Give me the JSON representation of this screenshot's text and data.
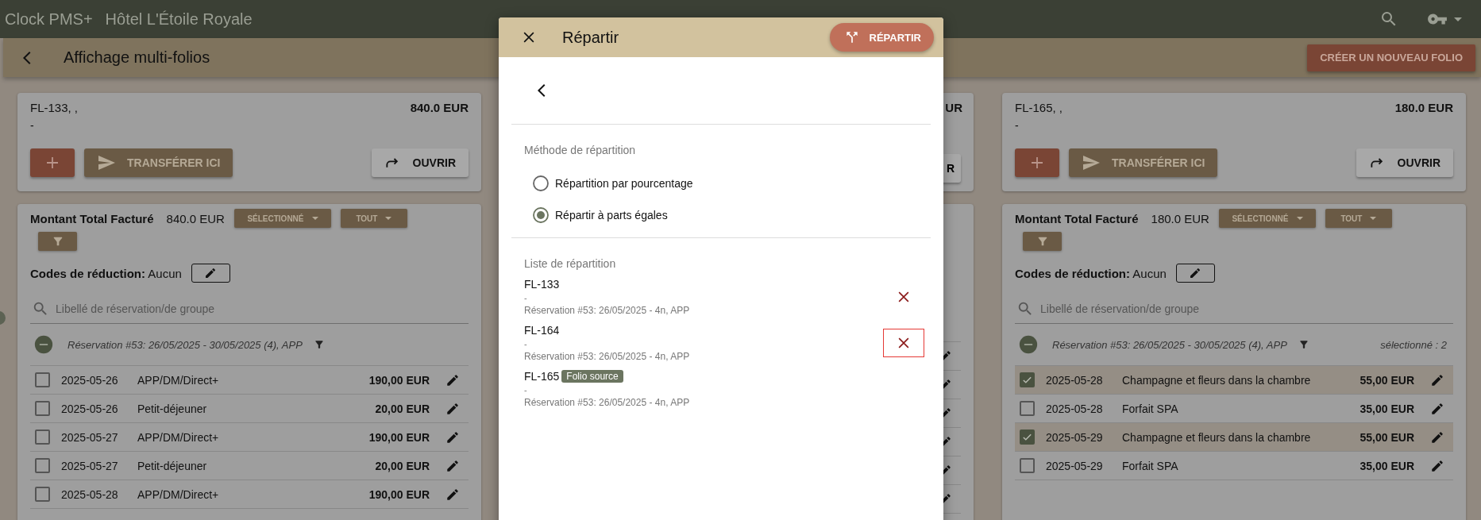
{
  "app_bar": {
    "brand": "Clock PMS+",
    "hotel": "Hôtel L'Étoile Royale"
  },
  "page_header": {
    "title": "Affichage multi-folios",
    "create_button": "CRÉER UN NOUVEAU FOLIO"
  },
  "folios": [
    {
      "name": "FL-133, ,",
      "subtitle": "-",
      "amount": "840.0 EUR",
      "transfer_button": "TRANSFÉRER ICI",
      "open_button": "OUVRIR",
      "total_label": "Montant Total Facturé",
      "total": "840.0 EUR",
      "selected_dropdown": "SÉLECTIONNÉ",
      "all_dropdown": "TOUT",
      "discount_label": "Codes de réduction:",
      "discount_value": "Aucun",
      "search_placeholder": "Libellé de réservation/de groupe",
      "group": {
        "label": "Réservation #53: 26/05/2025 - 30/05/2025 (4), APP",
        "expanded": true
      },
      "charges": [
        {
          "date": "2025-05-26",
          "description": "APP/DM/Direct+",
          "amount": "190,00 EUR",
          "checked": false
        },
        {
          "date": "2025-05-26",
          "description": "Petit-déjeuner",
          "amount": "20,00 EUR",
          "checked": false
        },
        {
          "date": "2025-05-27",
          "description": "APP/DM/Direct+",
          "amount": "190,00 EUR",
          "checked": false
        },
        {
          "date": "2025-05-27",
          "description": "Petit-déjeuner",
          "amount": "20,00 EUR",
          "checked": false
        },
        {
          "date": "2025-05-28",
          "description": "APP/DM/Direct+",
          "amount": "190,00 EUR",
          "checked": false
        }
      ]
    },
    {
      "name": "FL-165, ,",
      "subtitle": "-",
      "amount": "180.0 EUR",
      "transfer_button": "TRANSFÉRER ICI",
      "open_button": "OUVRIR",
      "total_label": "Montant Total Facturé",
      "total": "180.0 EUR",
      "selected_dropdown": "SÉLECTIONNÉ",
      "all_dropdown": "TOUT",
      "discount_label": "Codes de réduction:",
      "discount_value": "Aucun",
      "search_placeholder": "Libellé de réservation/de groupe",
      "group": {
        "label": "Réservation #53: 26/05/2025 - 30/05/2025 (4), APP",
        "expanded": true,
        "selection_count": "sélectionné : 2"
      },
      "charges": [
        {
          "date": "2025-05-28",
          "description": "Champagne et fleurs dans la chambre",
          "amount": "55,00 EUR",
          "checked": true
        },
        {
          "date": "2025-05-28",
          "description": "Forfait SPA",
          "amount": "35,00 EUR",
          "checked": false
        },
        {
          "date": "2025-05-29",
          "description": "Champagne et fleurs dans la chambre",
          "amount": "55,00 EUR",
          "checked": true
        },
        {
          "date": "2025-05-29",
          "description": "Forfait SPA",
          "amount": "35,00 EUR",
          "checked": false
        }
      ]
    }
  ],
  "hidden_folio_edge": {
    "amount": "UR",
    "open_button": "R"
  },
  "split_dialog": {
    "title": "Répartir",
    "submit_button": "RÉPARTIR",
    "method_heading": "Méthode de répartition",
    "methods": [
      {
        "label": "Répartition par pourcentage",
        "selected": false
      },
      {
        "label": "Répartir à parts égales",
        "selected": true
      }
    ],
    "list_heading": "Liste de répartition",
    "items": [
      {
        "name": "FL-133",
        "subtitle": "-",
        "reservation": "Réservation #53: 26/05/2025 - 4n, APP",
        "removable": true
      },
      {
        "name": "FL-164",
        "subtitle": "-",
        "reservation": "Réservation #53: 26/05/2025 - 4n, APP",
        "removable": true,
        "focused": true
      },
      {
        "name": "FL-165",
        "badge": "Folio source",
        "subtitle": "-",
        "reservation": "Réservation #53: 26/05/2025 - 4n, APP",
        "removable": false
      }
    ]
  }
}
